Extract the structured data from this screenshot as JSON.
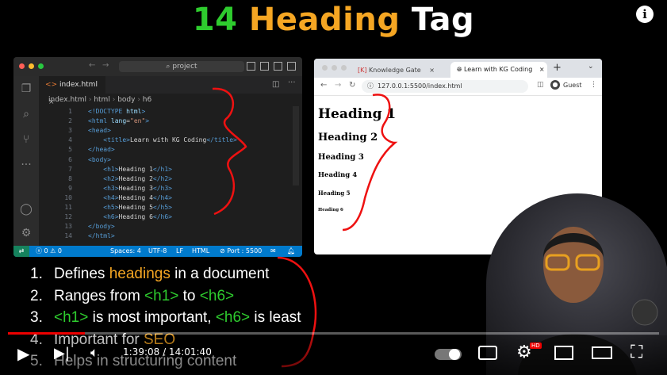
{
  "slide": {
    "title_num": "14",
    "title_heading": "Heading",
    "title_tag": "Tag",
    "info_icon": "i"
  },
  "vscode": {
    "search": "project",
    "tab_label": "index.html",
    "breadcrumb": [
      "index.html",
      "html",
      "body",
      "h6"
    ],
    "lines": [
      {
        "n": "1",
        "parts": [
          [
            "tagc",
            "<!DOCTYPE "
          ],
          [
            "attr",
            "html"
          ],
          [
            "tagc",
            ">"
          ]
        ]
      },
      {
        "n": "2",
        "parts": [
          [
            "tagc",
            "<html "
          ],
          [
            "attr",
            "lang"
          ],
          [
            "txt",
            "="
          ],
          [
            "str",
            "\"en\""
          ],
          [
            "tagc",
            ">"
          ]
        ]
      },
      {
        "n": "3",
        "parts": [
          [
            "tagc",
            "<head>"
          ]
        ]
      },
      {
        "n": "4",
        "parts": [
          [
            "txt",
            "    "
          ],
          [
            "tagc",
            "<title>"
          ],
          [
            "txt",
            "Learn with KG Coding"
          ],
          [
            "tagc",
            "</title>"
          ]
        ]
      },
      {
        "n": "5",
        "parts": [
          [
            "tagc",
            "</head>"
          ]
        ]
      },
      {
        "n": "6",
        "parts": [
          [
            "tagc",
            "<body>"
          ]
        ]
      },
      {
        "n": "7",
        "parts": [
          [
            "txt",
            "    "
          ],
          [
            "tagc",
            "<h1>"
          ],
          [
            "txt",
            "Heading 1"
          ],
          [
            "tagc",
            "</h1>"
          ]
        ]
      },
      {
        "n": "8",
        "parts": [
          [
            "txt",
            "    "
          ],
          [
            "tagc",
            "<h2>"
          ],
          [
            "txt",
            "Heading 2"
          ],
          [
            "tagc",
            "</h2>"
          ]
        ]
      },
      {
        "n": "9",
        "parts": [
          [
            "txt",
            "    "
          ],
          [
            "tagc",
            "<h3>"
          ],
          [
            "txt",
            "Heading 3"
          ],
          [
            "tagc",
            "</h3>"
          ]
        ]
      },
      {
        "n": "10",
        "parts": [
          [
            "txt",
            "    "
          ],
          [
            "tagc",
            "<h4>"
          ],
          [
            "txt",
            "Heading 4"
          ],
          [
            "tagc",
            "</h4>"
          ]
        ]
      },
      {
        "n": "11",
        "parts": [
          [
            "txt",
            "    "
          ],
          [
            "tagc",
            "<h5>"
          ],
          [
            "txt",
            "Heading 5"
          ],
          [
            "tagc",
            "</h5>"
          ]
        ]
      },
      {
        "n": "12",
        "parts": [
          [
            "txt",
            "    "
          ],
          [
            "tagc",
            "<h6>"
          ],
          [
            "txt",
            "Heading 6"
          ],
          [
            "tagc",
            "</h6>"
          ]
        ]
      },
      {
        "n": "13",
        "parts": [
          [
            "tagc",
            "</body>"
          ]
        ]
      },
      {
        "n": "14",
        "parts": [
          [
            "tagc",
            "</html>"
          ]
        ]
      }
    ],
    "status": {
      "errors": "0",
      "warnings": "0",
      "spaces": "Spaces: 4",
      "encoding": "UTF-8",
      "eol": "LF",
      "language": "HTML",
      "port": "Port : 5500"
    }
  },
  "browser": {
    "tab1": "Knowledge Gate",
    "tab2": "Learn with KG Coding",
    "url": "127.0.0.1:5500/index.html",
    "profile": "Guest",
    "headings": [
      "Heading 1",
      "Heading 2",
      "Heading 3",
      "Heading 4",
      "Heading 5",
      "Heading 6"
    ]
  },
  "list": [
    {
      "num": "1.",
      "parts": [
        [
          "",
          "Defines "
        ],
        [
          "orange",
          "headings"
        ],
        [
          "",
          " in a document"
        ]
      ]
    },
    {
      "num": "2.",
      "parts": [
        [
          "",
          "Ranges from "
        ],
        [
          "green",
          "<h1>"
        ],
        [
          "",
          " to "
        ],
        [
          "green",
          "<h6>"
        ]
      ]
    },
    {
      "num": "3.",
      "parts": [
        [
          "green",
          "<h1>"
        ],
        [
          "",
          " is most important, "
        ],
        [
          "green",
          "<h6>"
        ],
        [
          "",
          " is least"
        ]
      ]
    },
    {
      "num": "4.",
      "parts": [
        [
          "",
          "Important for "
        ],
        [
          "orange",
          "SEO"
        ]
      ]
    },
    {
      "num": "5.",
      "parts": [
        [
          "",
          "Helps in structuring content"
        ]
      ]
    }
  ],
  "player": {
    "time": "1:39:08 / 14:01:40",
    "progress": 0.118,
    "hd_badge": "HD"
  }
}
